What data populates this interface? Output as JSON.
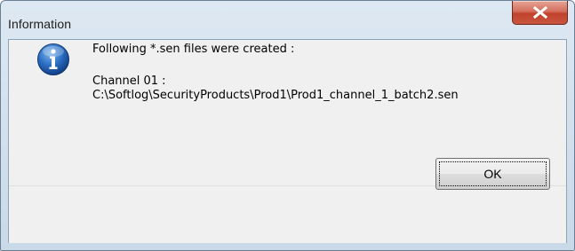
{
  "window": {
    "title": "Information"
  },
  "message": {
    "heading": "Following *.sen files were created :",
    "channel_label": "Channel 01 :",
    "file_path": "C:\\Softlog\\SecurityProducts\\Prod1\\Prod1_channel_1_batch2.sen"
  },
  "buttons": {
    "ok_label": "OK",
    "close_symbol": "X"
  },
  "icons": {
    "message_icon": "information-icon",
    "close_icon": "close-icon"
  },
  "colors": {
    "close_button": "#c9553f",
    "info_icon": "#1a5fb4",
    "client_background": "#f0f0f0"
  }
}
